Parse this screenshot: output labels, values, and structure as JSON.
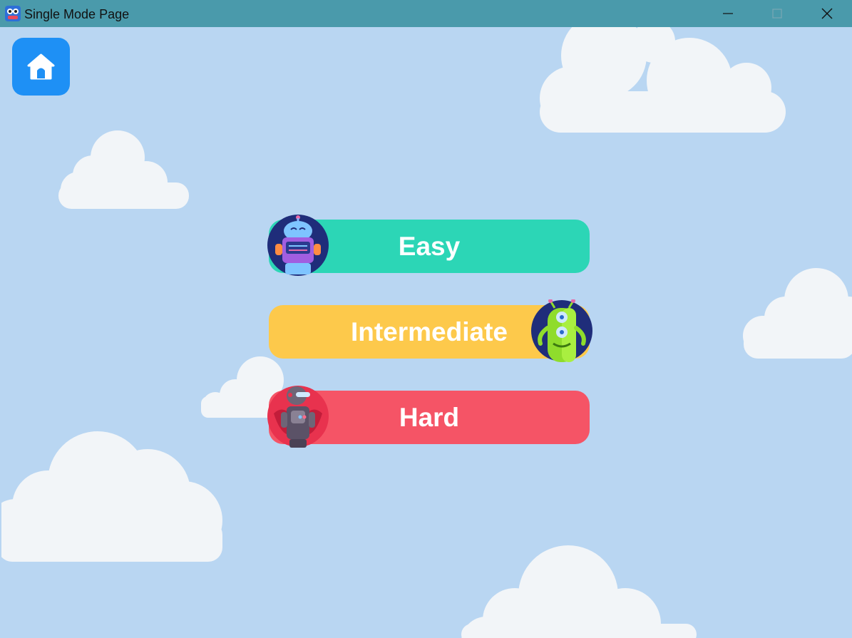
{
  "window": {
    "title": "Single Mode Page",
    "app_icon": "robot-app-icon",
    "controls": [
      "minimize-icon",
      "maximize-icon",
      "close-icon"
    ]
  },
  "home": {
    "icon": "home-icon",
    "color": "#1e90f5"
  },
  "modes": [
    {
      "label": "Easy",
      "color": "#2cd6b6",
      "avatar": "robot-avatar-icon"
    },
    {
      "label": "Intermediate",
      "color": "#fdc94b",
      "avatar": "green-monster-avatar-icon"
    },
    {
      "label": "Hard",
      "color": "#f55466",
      "avatar": "gray-robot-avatar-icon"
    }
  ],
  "colors": {
    "background": "#b9d6f2",
    "titlebar": "#4a9aab"
  }
}
